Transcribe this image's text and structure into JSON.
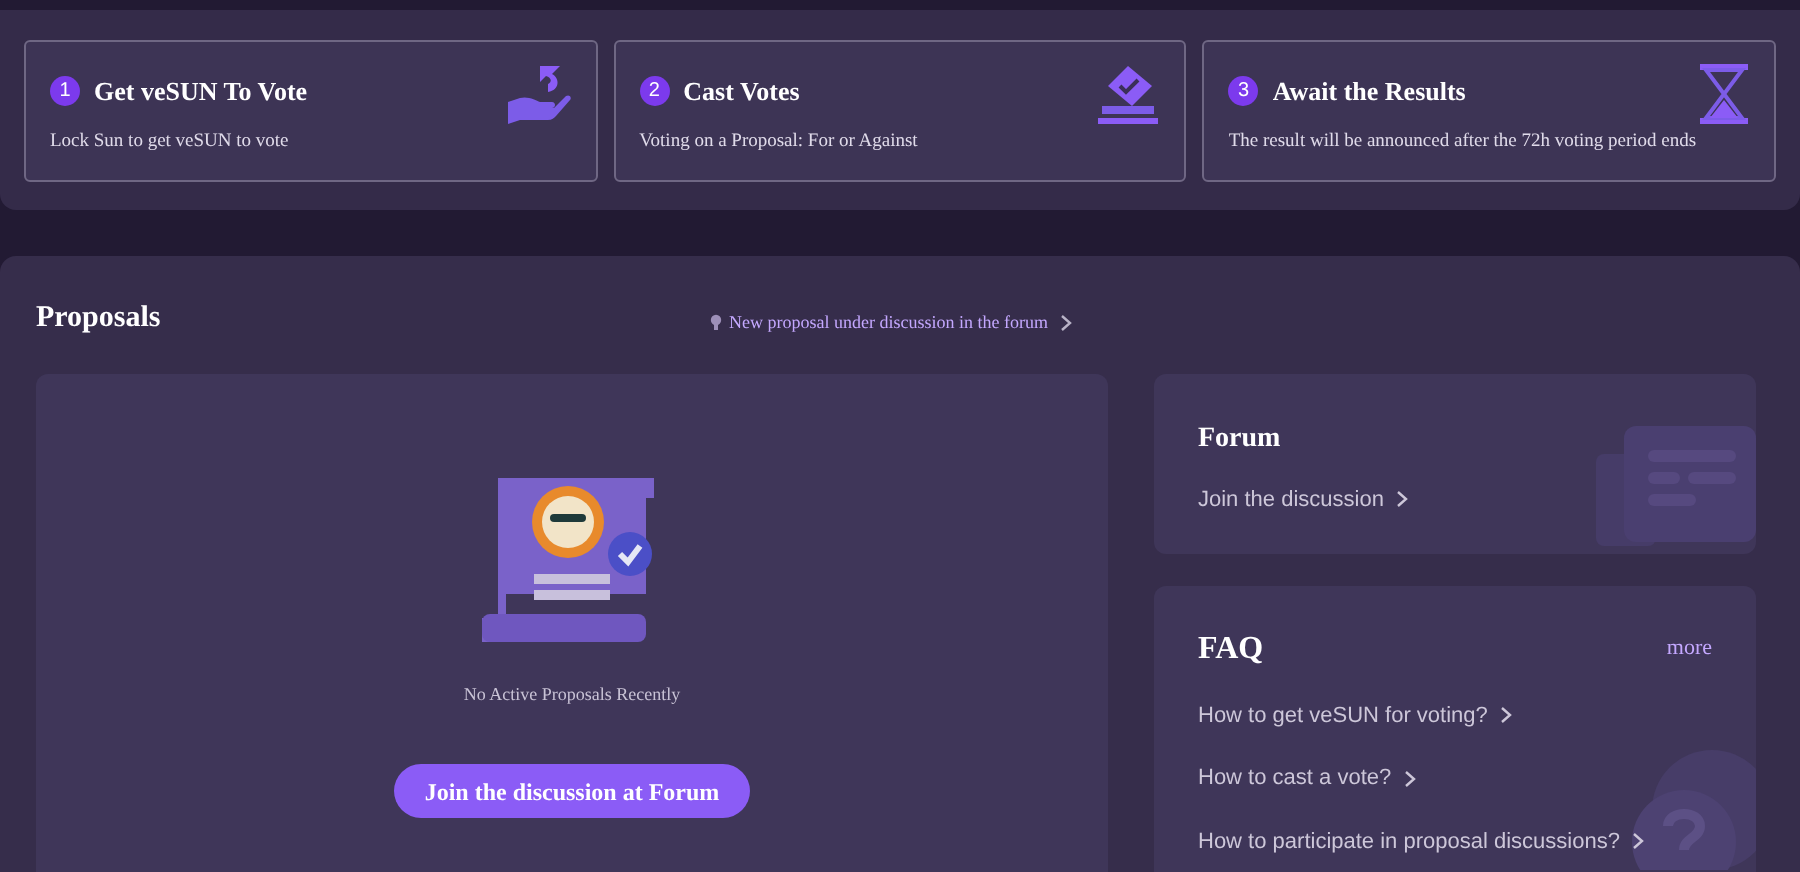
{
  "steps": [
    {
      "number": "1",
      "title": "Get veSUN To Vote",
      "description": "Lock Sun to get veSUN to vote",
      "kind": "hand"
    },
    {
      "number": "2",
      "title": "Cast Votes",
      "description": "Voting on a Proposal: For or Against",
      "kind": "ballot"
    },
    {
      "number": "3",
      "title": "Await the Results",
      "description": "The result will be announced after the 72h voting period ends",
      "kind": "hourglass"
    }
  ],
  "proposals": {
    "title": "Proposals",
    "forum_notice": "New proposal under discussion in the forum",
    "empty_text": "No Active Proposals Recently",
    "button": "Join the discussion at Forum"
  },
  "forum": {
    "title": "Forum",
    "link": "Join the discussion"
  },
  "faq": {
    "title": "FAQ",
    "more": "more",
    "questions": [
      "How to get veSUN for voting?",
      "How to cast a vote?",
      "How to participate in proposal discussions?"
    ]
  }
}
